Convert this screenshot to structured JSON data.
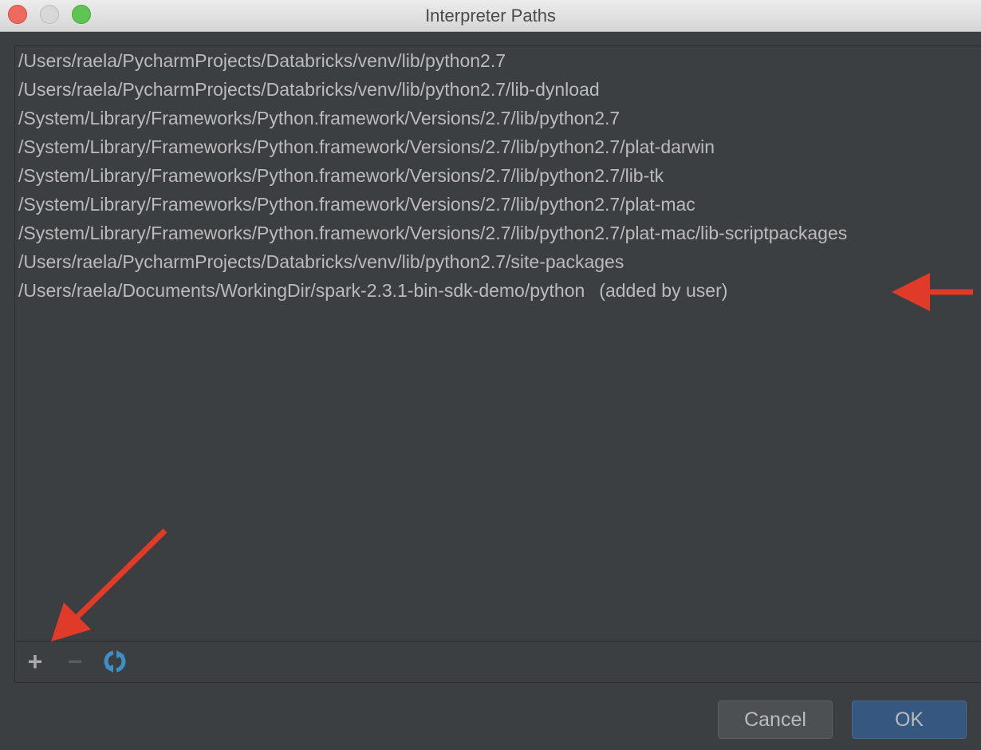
{
  "window": {
    "title": "Interpreter Paths"
  },
  "paths": [
    {
      "path": "/Users/raela/PycharmProjects/Databricks/venv/lib/python2.7"
    },
    {
      "path": "/Users/raela/PycharmProjects/Databricks/venv/lib/python2.7/lib-dynload"
    },
    {
      "path": "/System/Library/Frameworks/Python.framework/Versions/2.7/lib/python2.7"
    },
    {
      "path": "/System/Library/Frameworks/Python.framework/Versions/2.7/lib/python2.7/plat-darwin"
    },
    {
      "path": "/System/Library/Frameworks/Python.framework/Versions/2.7/lib/python2.7/lib-tk"
    },
    {
      "path": "/System/Library/Frameworks/Python.framework/Versions/2.7/lib/python2.7/plat-mac"
    },
    {
      "path": "/System/Library/Frameworks/Python.framework/Versions/2.7/lib/python2.7/plat-mac/lib-scriptpackages"
    },
    {
      "path": "/Users/raela/PycharmProjects/Databricks/venv/lib/python2.7/site-packages"
    },
    {
      "path": "/Users/raela/Documents/WorkingDir/spark-2.3.1-bin-sdk-demo/python",
      "note": "(added by user)"
    }
  ],
  "toolbar": {
    "add": "+",
    "remove": "−"
  },
  "buttons": {
    "cancel": "Cancel",
    "ok": "OK"
  },
  "colors": {
    "accent": "#365880",
    "annotation": "#e03a28",
    "refresh": "#3d8fc6"
  }
}
